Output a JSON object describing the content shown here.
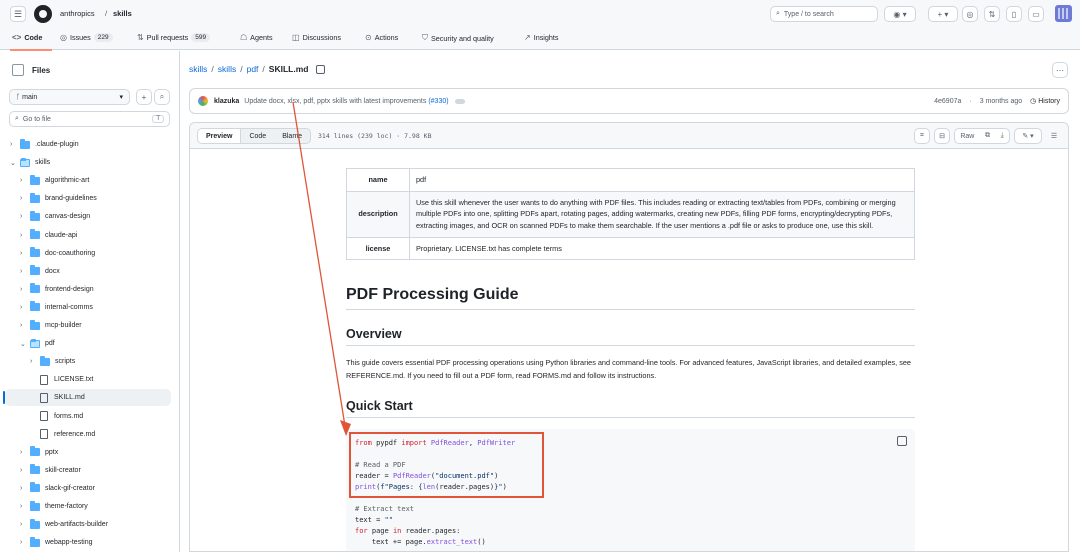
{
  "header": {
    "owner": "anthropics",
    "repo": "skills",
    "search_placeholder": "Type / to search"
  },
  "tabs": [
    {
      "label": "Code",
      "count": ""
    },
    {
      "label": "Issues",
      "count": "229"
    },
    {
      "label": "Pull requests",
      "count": "599"
    },
    {
      "label": "Agents",
      "count": ""
    },
    {
      "label": "Discussions",
      "count": ""
    },
    {
      "label": "Actions",
      "count": ""
    },
    {
      "label": "Security and quality",
      "count": ""
    },
    {
      "label": "Insights",
      "count": ""
    }
  ],
  "sidebar": {
    "title": "Files",
    "branch": "main",
    "goto_placeholder": "Go to file",
    "goto_kbd": "T",
    "items": [
      {
        "label": ".claude-plugin",
        "type": "folder",
        "depth": 0,
        "open": false
      },
      {
        "label": "skills",
        "type": "folder",
        "depth": 0,
        "open": true
      },
      {
        "label": "algorithmic-art",
        "type": "folder",
        "depth": 1,
        "open": false
      },
      {
        "label": "brand-guidelines",
        "type": "folder",
        "depth": 1,
        "open": false
      },
      {
        "label": "canvas-design",
        "type": "folder",
        "depth": 1,
        "open": false
      },
      {
        "label": "claude-api",
        "type": "folder",
        "depth": 1,
        "open": false
      },
      {
        "label": "doc-coauthoring",
        "type": "folder",
        "depth": 1,
        "open": false
      },
      {
        "label": "docx",
        "type": "folder",
        "depth": 1,
        "open": false
      },
      {
        "label": "frontend-design",
        "type": "folder",
        "depth": 1,
        "open": false
      },
      {
        "label": "internal-comms",
        "type": "folder",
        "depth": 1,
        "open": false
      },
      {
        "label": "mcp-builder",
        "type": "folder",
        "depth": 1,
        "open": false
      },
      {
        "label": "pdf",
        "type": "folder",
        "depth": 1,
        "open": true
      },
      {
        "label": "scripts",
        "type": "folder",
        "depth": 2,
        "open": false
      },
      {
        "label": "LICENSE.txt",
        "type": "file",
        "depth": 2
      },
      {
        "label": "SKILL.md",
        "type": "file",
        "depth": 2,
        "selected": true
      },
      {
        "label": "forms.md",
        "type": "file",
        "depth": 2
      },
      {
        "label": "reference.md",
        "type": "file",
        "depth": 2
      },
      {
        "label": "pptx",
        "type": "folder",
        "depth": 1,
        "open": false
      },
      {
        "label": "skill-creator",
        "type": "folder",
        "depth": 1,
        "open": false
      },
      {
        "label": "slack-gif-creator",
        "type": "folder",
        "depth": 1,
        "open": false
      },
      {
        "label": "theme-factory",
        "type": "folder",
        "depth": 1,
        "open": false
      },
      {
        "label": "web-artifacts-builder",
        "type": "folder",
        "depth": 1,
        "open": false
      },
      {
        "label": "webapp-testing",
        "type": "folder",
        "depth": 1,
        "open": false
      }
    ]
  },
  "breadcrumb": {
    "parts": [
      "skills",
      "skills",
      "pdf"
    ],
    "current": "SKILL.md"
  },
  "commit": {
    "author": "klazuka",
    "message": "Update docx, xlsx, pdf, pptx skills with latest improvements",
    "pr": "(#330)",
    "sha": "4e6907a",
    "age": "3 months ago",
    "history_label": "History"
  },
  "file_header": {
    "views": [
      "Preview",
      "Code",
      "Blame"
    ],
    "meta": "314 lines (239 loc) · 7.98 KB",
    "raw_label": "Raw"
  },
  "frontmatter": [
    {
      "key": "name",
      "value": "pdf"
    },
    {
      "key": "description",
      "value": "Use this skill whenever the user wants to do anything with PDF files. This includes reading or extracting text/tables from PDFs, combining or merging multiple PDFs into one, splitting PDFs apart, rotating pages, adding watermarks, creating new PDFs, filling PDF forms, encrypting/decrypting PDFs, extracting images, and OCR on scanned PDFs to make them searchable. If the user mentions a .pdf file or asks to produce one, use this skill."
    },
    {
      "key": "license",
      "value": "Proprietary. LICENSE.txt has complete terms"
    }
  ],
  "doc": {
    "h1": "PDF Processing Guide",
    "h2_overview": "Overview",
    "overview_text": "This guide covers essential PDF processing operations using Python libraries and command-line tools. For advanced features, JavaScript libraries, and detailed examples, see REFERENCE.md. If you need to fill out a PDF form, read FORMS.md and follow its instructions.",
    "h2_quickstart": "Quick Start"
  },
  "code": {
    "l1_kw1": "from",
    "l1_mid": " pypdf ",
    "l1_kw2": "import",
    "l1_fn1": " PdfReader",
    "l1_sep": ", ",
    "l1_fn2": "PdfWriter",
    "l3_comment": "# Read a PDF",
    "l4_a": "reader = ",
    "l4_fn": "PdfReader",
    "l4_b": "(",
    "l4_str": "\"document.pdf\"",
    "l4_c": ")",
    "l5_fn": "print",
    "l5_a": "(",
    "l5_str": "f\"Pages: {",
    "l5_fn2": "len",
    "l5_b": "(reader.pages)",
    "l5_str2": "}\"",
    "l5_c": ")",
    "l7_comment": "# Extract text",
    "l8_a": "text = ",
    "l8_str": "\"\"",
    "l9_kw1": "for",
    "l9_a": " page ",
    "l9_kw2": "in",
    "l9_b": " reader.pages:",
    "l10_a": "    text += page.",
    "l10_fn": "extract_text",
    "l10_b": "()"
  },
  "colors": {
    "accent": "#0969da",
    "annotation": "#e0553a",
    "tab_underline": "#fd8c73"
  }
}
